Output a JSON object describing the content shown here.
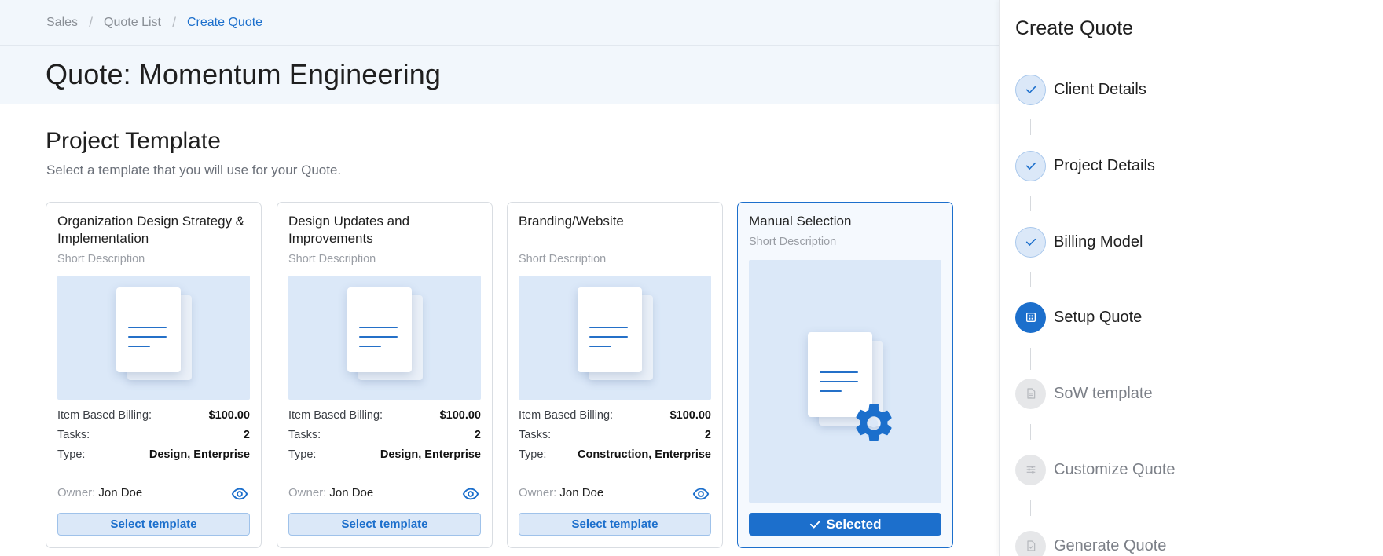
{
  "breadcrumb": {
    "items": [
      "Sales",
      "Quote List"
    ],
    "current": "Create Quote"
  },
  "page_title": "Quote: Momentum Engineering",
  "section": {
    "title": "Project Template",
    "subtitle": "Select a template that you will use for your Quote."
  },
  "cards": [
    {
      "title": "Organization Design Strategy & Implementation",
      "short": "Short Description",
      "billing_label": "Item Based Billing:",
      "billing_value": "$100.00",
      "tasks_label": "Tasks:",
      "tasks_value": "2",
      "type_label": "Type:",
      "type_value": "Design, Enterprise",
      "owner_label": "Owner:",
      "owner_value": "Jon Doe",
      "button": "Select template"
    },
    {
      "title": "Design Updates and Improvements",
      "short": "Short Description",
      "billing_label": "Item Based Billing:",
      "billing_value": "$100.00",
      "tasks_label": "Tasks:",
      "tasks_value": "2",
      "type_label": "Type:",
      "type_value": "Design, Enterprise",
      "owner_label": "Owner:",
      "owner_value": "Jon Doe",
      "button": "Select template"
    },
    {
      "title": "Branding/Website",
      "short": "Short Description",
      "billing_label": "Item Based Billing:",
      "billing_value": "$100.00",
      "tasks_label": "Tasks:",
      "tasks_value": "2",
      "type_label": "Type:",
      "type_value": "Construction, Enterprise",
      "owner_label": "Owner:",
      "owner_value": "Jon Doe",
      "button": "Select template"
    },
    {
      "title": "Manual Selection",
      "short": "Short Description",
      "button": "Selected"
    }
  ],
  "sidebar": {
    "title": "Create Quote",
    "steps": [
      {
        "label": "Client Details",
        "state": "done",
        "icon": "check-icon"
      },
      {
        "label": "Project Details",
        "state": "done",
        "icon": "check-icon"
      },
      {
        "label": "Billing Model",
        "state": "done",
        "icon": "check-icon"
      },
      {
        "label": "Setup Quote",
        "state": "active",
        "icon": "calculator-icon"
      },
      {
        "label": "SoW template",
        "state": "pending",
        "icon": "document-icon"
      },
      {
        "label": "Customize Quote",
        "state": "pending",
        "icon": "sliders-icon"
      },
      {
        "label": "Generate Quote",
        "state": "pending",
        "icon": "document-check-icon"
      }
    ]
  },
  "colors": {
    "accent": "#1c6fcc",
    "preview_bg": "#dbe8f8",
    "header_bg": "#f2f7fc"
  }
}
